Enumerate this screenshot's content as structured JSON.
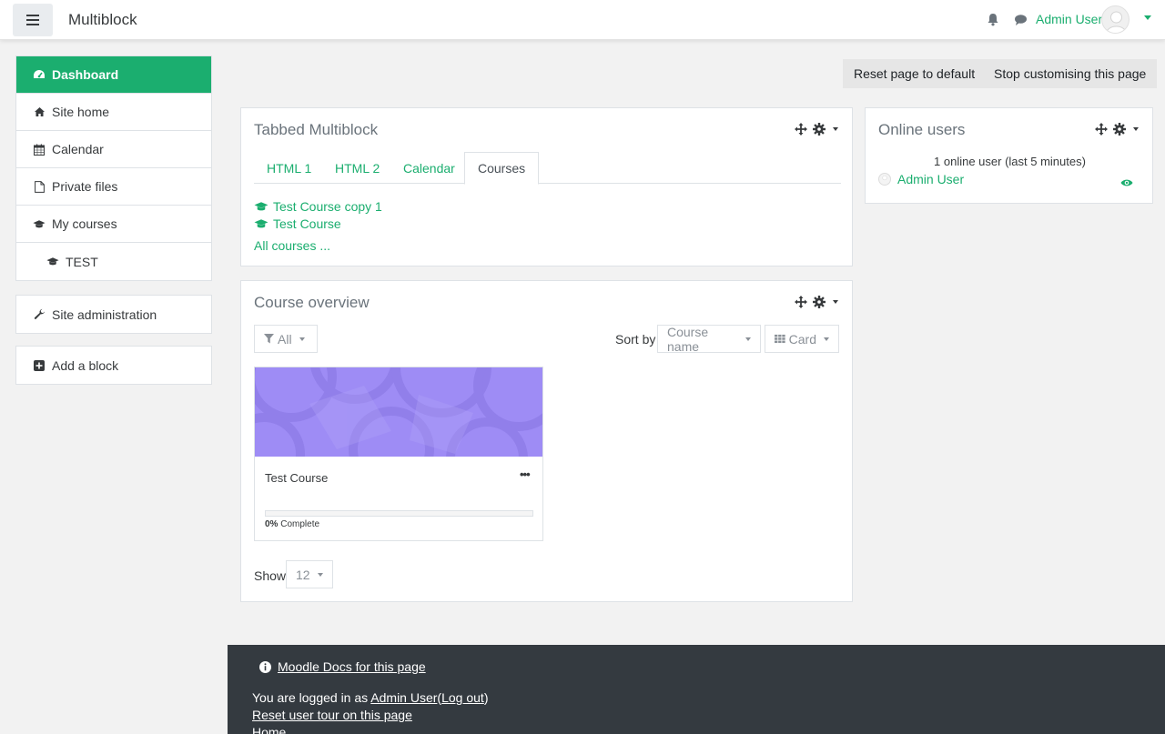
{
  "navbar": {
    "menu_icon": "hamburger-icon",
    "site_name": "Multiblock",
    "notifications_icon": "bell-icon",
    "messages_icon": "chat-icon",
    "user_name": "Admin User",
    "accent_color": "#1bae6f"
  },
  "sidebar": {
    "items": [
      {
        "label": "Dashboard",
        "icon": "dashboard-icon",
        "active": true
      },
      {
        "label": "Site home",
        "icon": "home-icon"
      },
      {
        "label": "Calendar",
        "icon": "calendar-icon"
      },
      {
        "label": "Private files",
        "icon": "file-icon"
      },
      {
        "label": "My courses",
        "icon": "graduation-cap-icon"
      },
      {
        "label": "TEST",
        "icon": "graduation-cap-icon"
      }
    ],
    "site_admin": {
      "label": "Site administration",
      "icon": "wrench-icon"
    },
    "add_block": {
      "label": "Add a block",
      "icon": "plus-square-icon"
    }
  },
  "page_actions": {
    "reset": "Reset page to default",
    "stop": "Stop customising this page"
  },
  "tabbed_block": {
    "title": "Tabbed Multiblock",
    "tabs": [
      "HTML 1",
      "HTML 2",
      "Calendar",
      "Courses"
    ],
    "active_tab": "Courses",
    "courses": [
      "Test Course copy 1",
      "Test Course"
    ],
    "all_courses": "All courses ..."
  },
  "course_overview": {
    "title": "Course overview",
    "filter": "All",
    "sort_label": "Sort by",
    "sort_value": "Course name",
    "view_value": "Card",
    "card": {
      "name": "Test Course",
      "progress_percent": "0%",
      "progress_label": "Complete",
      "progress_value": 0,
      "image_color": "#9e8cf5"
    },
    "show_label": "Show",
    "show_value": "12"
  },
  "online_users": {
    "title": "Online users",
    "summary": "1 online user (last 5 minutes)",
    "user": "Admin User"
  },
  "footer": {
    "docs_link": "Moodle Docs for this page",
    "logged_in_prefix": "You are logged in as",
    "logged_in_user": "Admin User",
    "logout": "Log out",
    "reset_tour": "Reset user tour on this page",
    "home": "Home"
  }
}
